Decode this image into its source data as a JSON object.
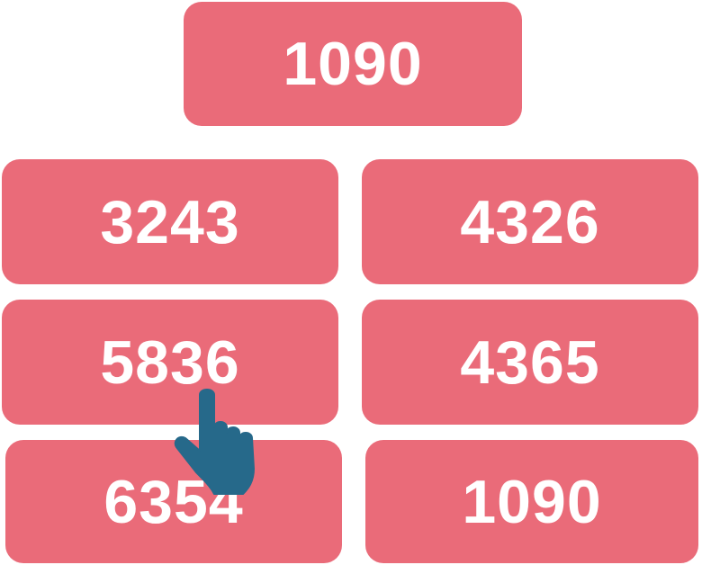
{
  "target": {
    "value": "1090"
  },
  "options": [
    {
      "value": "3243"
    },
    {
      "value": "4326"
    },
    {
      "value": "5836"
    },
    {
      "value": "4365"
    },
    {
      "value": "6354"
    },
    {
      "value": "1090"
    }
  ],
  "colors": {
    "tile": "#ea6b79",
    "text": "#ffffff",
    "cursor": "#26698a"
  },
  "cursor": {
    "icon": "pointing-hand-icon"
  }
}
